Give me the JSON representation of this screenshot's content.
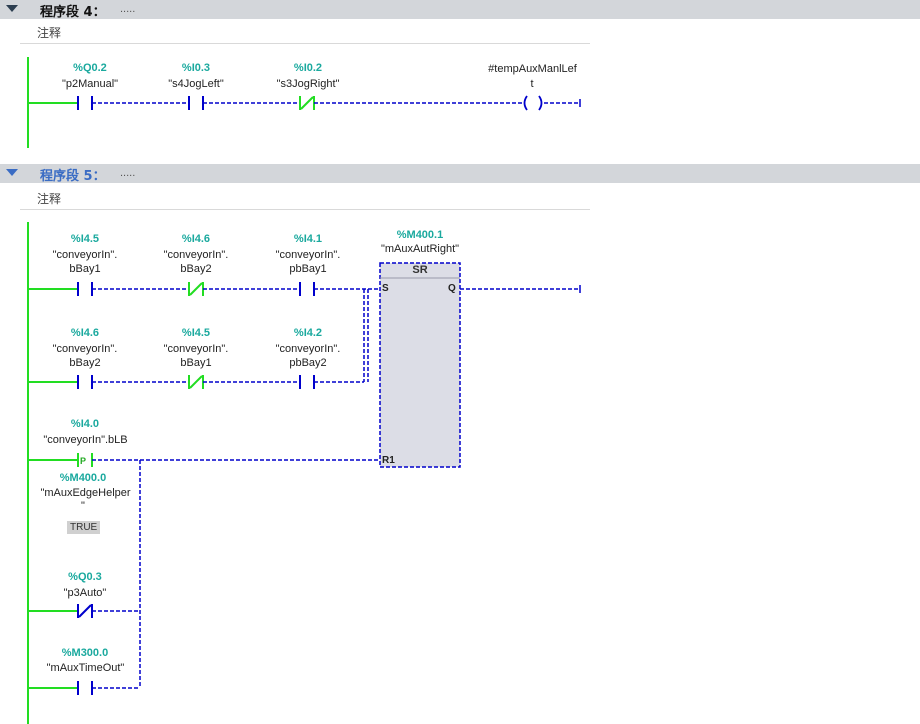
{
  "segment4": {
    "title": "程序段 4：",
    "dots": ".....",
    "comment_label": "注释",
    "contacts": [
      {
        "address": "%Q0.2",
        "tag": "\"p2Manual\"",
        "type": "NO"
      },
      {
        "address": "%I0.3",
        "tag": "\"s4JogLeft\"",
        "type": "NO"
      },
      {
        "address": "%I0.2",
        "tag": "\"s3JogRight\"",
        "type": "NC"
      }
    ],
    "coil": {
      "tag_line1": "#tempAuxManlLef",
      "tag_line2": "t"
    }
  },
  "segment5": {
    "title": "程序段 5：",
    "dots": ".....",
    "comment_label": "注释",
    "row1": [
      {
        "address": "%I4.5",
        "tag_line1": "\"conveyorIn\".",
        "tag_line2": "bBay1",
        "type": "NO"
      },
      {
        "address": "%I4.6",
        "tag_line1": "\"conveyorIn\".",
        "tag_line2": "bBay2",
        "type": "NC"
      },
      {
        "address": "%I4.1",
        "tag_line1": "\"conveyorIn\".",
        "tag_line2": "pbBay1",
        "type": "NO"
      }
    ],
    "row2": [
      {
        "address": "%I4.6",
        "tag_line1": "\"conveyorIn\".",
        "tag_line2": "bBay2",
        "type": "NO"
      },
      {
        "address": "%I4.5",
        "tag_line1": "\"conveyorIn\".",
        "tag_line2": "bBay1",
        "type": "NC"
      },
      {
        "address": "%I4.2",
        "tag_line1": "\"conveyorIn\".",
        "tag_line2": "pbBay2",
        "type": "NO"
      }
    ],
    "sr_block": {
      "address": "%M400.1",
      "tag": "\"mAuxAutRight\"",
      "title": "SR",
      "pin_s": "S",
      "pin_r1": "R1",
      "pin_q": "Q"
    },
    "edge_contact": {
      "address": "%I4.0",
      "tag": "\"conveyorIn\".bLB",
      "edge_label": "P",
      "helper_address": "%M400.0",
      "helper_tag_line1": "\"mAuxEdgeHelper",
      "helper_tag_line2": "\"",
      "status": "TRUE"
    },
    "auto_contact": {
      "address": "%Q0.3",
      "tag": "\"p3Auto\"",
      "type": "NC"
    },
    "timeout_contact": {
      "address": "%M300.0",
      "tag": "\"mAuxTimeOut\"",
      "type": "NO"
    }
  },
  "colors": {
    "power": "#22dd22",
    "dashed": "#0000cc",
    "address": "#1aa99e",
    "header": "#d3d6da",
    "accent": "#3a6cc4"
  }
}
